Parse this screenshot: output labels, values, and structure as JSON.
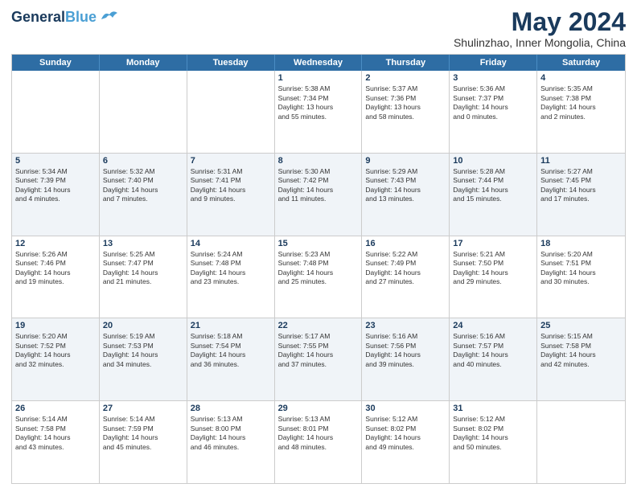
{
  "header": {
    "logo_line1": "General",
    "logo_line2": "Blue",
    "main_title": "May 2024",
    "subtitle": "Shulinzhao, Inner Mongolia, China"
  },
  "days": [
    "Sunday",
    "Monday",
    "Tuesday",
    "Wednesday",
    "Thursday",
    "Friday",
    "Saturday"
  ],
  "weeks": [
    {
      "alt": false,
      "cells": [
        {
          "date": "",
          "info": ""
        },
        {
          "date": "",
          "info": ""
        },
        {
          "date": "",
          "info": ""
        },
        {
          "date": "1",
          "info": "Sunrise: 5:38 AM\nSunset: 7:34 PM\nDaylight: 13 hours\nand 55 minutes."
        },
        {
          "date": "2",
          "info": "Sunrise: 5:37 AM\nSunset: 7:36 PM\nDaylight: 13 hours\nand 58 minutes."
        },
        {
          "date": "3",
          "info": "Sunrise: 5:36 AM\nSunset: 7:37 PM\nDaylight: 14 hours\nand 0 minutes."
        },
        {
          "date": "4",
          "info": "Sunrise: 5:35 AM\nSunset: 7:38 PM\nDaylight: 14 hours\nand 2 minutes."
        }
      ]
    },
    {
      "alt": true,
      "cells": [
        {
          "date": "5",
          "info": "Sunrise: 5:34 AM\nSunset: 7:39 PM\nDaylight: 14 hours\nand 4 minutes."
        },
        {
          "date": "6",
          "info": "Sunrise: 5:32 AM\nSunset: 7:40 PM\nDaylight: 14 hours\nand 7 minutes."
        },
        {
          "date": "7",
          "info": "Sunrise: 5:31 AM\nSunset: 7:41 PM\nDaylight: 14 hours\nand 9 minutes."
        },
        {
          "date": "8",
          "info": "Sunrise: 5:30 AM\nSunset: 7:42 PM\nDaylight: 14 hours\nand 11 minutes."
        },
        {
          "date": "9",
          "info": "Sunrise: 5:29 AM\nSunset: 7:43 PM\nDaylight: 14 hours\nand 13 minutes."
        },
        {
          "date": "10",
          "info": "Sunrise: 5:28 AM\nSunset: 7:44 PM\nDaylight: 14 hours\nand 15 minutes."
        },
        {
          "date": "11",
          "info": "Sunrise: 5:27 AM\nSunset: 7:45 PM\nDaylight: 14 hours\nand 17 minutes."
        }
      ]
    },
    {
      "alt": false,
      "cells": [
        {
          "date": "12",
          "info": "Sunrise: 5:26 AM\nSunset: 7:46 PM\nDaylight: 14 hours\nand 19 minutes."
        },
        {
          "date": "13",
          "info": "Sunrise: 5:25 AM\nSunset: 7:47 PM\nDaylight: 14 hours\nand 21 minutes."
        },
        {
          "date": "14",
          "info": "Sunrise: 5:24 AM\nSunset: 7:48 PM\nDaylight: 14 hours\nand 23 minutes."
        },
        {
          "date": "15",
          "info": "Sunrise: 5:23 AM\nSunset: 7:48 PM\nDaylight: 14 hours\nand 25 minutes."
        },
        {
          "date": "16",
          "info": "Sunrise: 5:22 AM\nSunset: 7:49 PM\nDaylight: 14 hours\nand 27 minutes."
        },
        {
          "date": "17",
          "info": "Sunrise: 5:21 AM\nSunset: 7:50 PM\nDaylight: 14 hours\nand 29 minutes."
        },
        {
          "date": "18",
          "info": "Sunrise: 5:20 AM\nSunset: 7:51 PM\nDaylight: 14 hours\nand 30 minutes."
        }
      ]
    },
    {
      "alt": true,
      "cells": [
        {
          "date": "19",
          "info": "Sunrise: 5:20 AM\nSunset: 7:52 PM\nDaylight: 14 hours\nand 32 minutes."
        },
        {
          "date": "20",
          "info": "Sunrise: 5:19 AM\nSunset: 7:53 PM\nDaylight: 14 hours\nand 34 minutes."
        },
        {
          "date": "21",
          "info": "Sunrise: 5:18 AM\nSunset: 7:54 PM\nDaylight: 14 hours\nand 36 minutes."
        },
        {
          "date": "22",
          "info": "Sunrise: 5:17 AM\nSunset: 7:55 PM\nDaylight: 14 hours\nand 37 minutes."
        },
        {
          "date": "23",
          "info": "Sunrise: 5:16 AM\nSunset: 7:56 PM\nDaylight: 14 hours\nand 39 minutes."
        },
        {
          "date": "24",
          "info": "Sunrise: 5:16 AM\nSunset: 7:57 PM\nDaylight: 14 hours\nand 40 minutes."
        },
        {
          "date": "25",
          "info": "Sunrise: 5:15 AM\nSunset: 7:58 PM\nDaylight: 14 hours\nand 42 minutes."
        }
      ]
    },
    {
      "alt": false,
      "cells": [
        {
          "date": "26",
          "info": "Sunrise: 5:14 AM\nSunset: 7:58 PM\nDaylight: 14 hours\nand 43 minutes."
        },
        {
          "date": "27",
          "info": "Sunrise: 5:14 AM\nSunset: 7:59 PM\nDaylight: 14 hours\nand 45 minutes."
        },
        {
          "date": "28",
          "info": "Sunrise: 5:13 AM\nSunset: 8:00 PM\nDaylight: 14 hours\nand 46 minutes."
        },
        {
          "date": "29",
          "info": "Sunrise: 5:13 AM\nSunset: 8:01 PM\nDaylight: 14 hours\nand 48 minutes."
        },
        {
          "date": "30",
          "info": "Sunrise: 5:12 AM\nSunset: 8:02 PM\nDaylight: 14 hours\nand 49 minutes."
        },
        {
          "date": "31",
          "info": "Sunrise: 5:12 AM\nSunset: 8:02 PM\nDaylight: 14 hours\nand 50 minutes."
        },
        {
          "date": "",
          "info": ""
        }
      ]
    }
  ]
}
